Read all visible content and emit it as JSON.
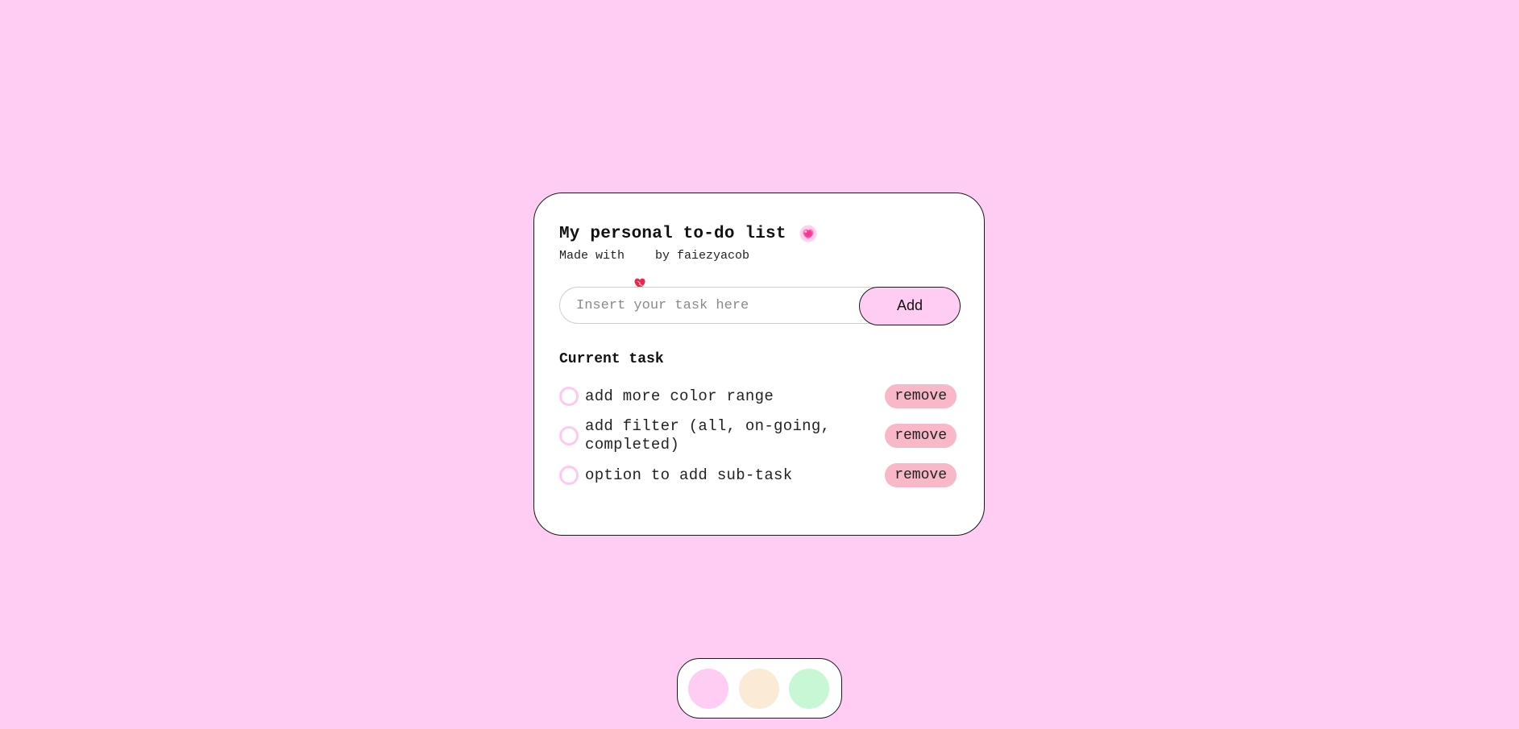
{
  "header": {
    "title": "My personal to-do list",
    "subtitle_prefix": "Made with",
    "subtitle_suffix": "by faiezyacob",
    "title_icon": "sparkling-heart-icon",
    "subtitle_icon": "heart-icon"
  },
  "input": {
    "placeholder": "Insert your task here",
    "value": "",
    "add_label": "Add"
  },
  "section": {
    "title": "Current task"
  },
  "tasks": [
    {
      "text": "add more color range",
      "completed": false,
      "remove_label": "remove"
    },
    {
      "text": "add filter (all, on-going, completed)",
      "completed": false,
      "remove_label": "remove"
    },
    {
      "text": "option to add sub-task",
      "completed": false,
      "remove_label": "remove"
    }
  ],
  "themes": [
    {
      "name": "pink",
      "color": "#ffcdf3"
    },
    {
      "name": "cream",
      "color": "#fbead5"
    },
    {
      "name": "mint",
      "color": "#c8f7d6"
    }
  ],
  "colors": {
    "background": "#ffcdf3",
    "accent": "#ffcdf3",
    "remove_button": "#f8b8c8",
    "checkbox_border": "#ffc8ef"
  }
}
